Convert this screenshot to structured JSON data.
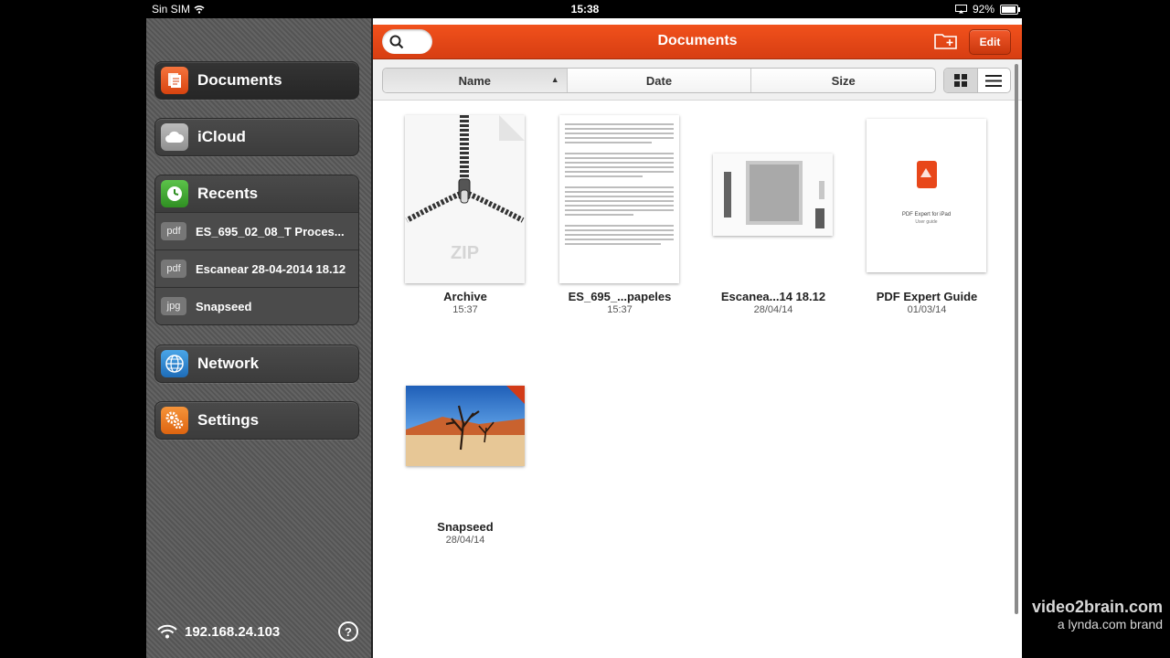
{
  "status": {
    "carrier": "Sin SIM",
    "time": "15:38",
    "battery": "92%",
    "battery_level": 0.92
  },
  "sidebar": {
    "documents": "Documents",
    "icloud": "iCloud",
    "recents": {
      "label": "Recents",
      "items": [
        {
          "tag": "pdf",
          "name": "ES_695_02_08_T Proces..."
        },
        {
          "tag": "pdf",
          "name": "Escanear 28-04-2014 18.12"
        },
        {
          "tag": "jpg",
          "name": "Snapseed"
        }
      ]
    },
    "network": "Network",
    "settings": "Settings",
    "ip": "192.168.24.103",
    "help": "?"
  },
  "toolbar": {
    "title": "Documents",
    "edit": "Edit"
  },
  "sort": {
    "name": "Name",
    "date": "Date",
    "size": "Size",
    "arrow": "▲"
  },
  "files": [
    {
      "name": "Archive",
      "date": "15:37",
      "zip_label": "ZIP"
    },
    {
      "name": "ES_695_...papeles",
      "date": "15:37"
    },
    {
      "name": "Escanea...14 18.12",
      "date": "28/04/14"
    },
    {
      "name": "PDF Expert Guide",
      "date": "01/03/14",
      "cover_title": "PDF Expert for iPad",
      "cover_sub": "User guide"
    },
    {
      "name": "Snapseed",
      "date": "28/04/14"
    }
  ],
  "watermark": {
    "line1": "video2brain.com",
    "line2": "a lynda.com brand"
  },
  "colors": {
    "accent": "#e8471a",
    "sidebar": "#5e5e5e"
  },
  "icons": [
    "documents-icon",
    "cloud-icon",
    "clock-icon",
    "globe-icon",
    "gears-icon",
    "wifi-icon",
    "search-icon",
    "new-folder-icon",
    "grid-view-icon",
    "list-view-icon"
  ]
}
